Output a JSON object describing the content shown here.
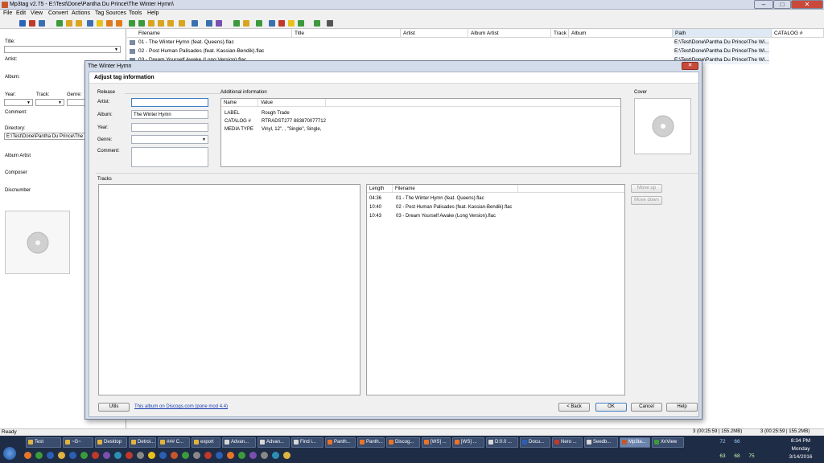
{
  "window": {
    "title": "Mp3tag v2.75  -  E:\\Test\\Done\\Pantha Du Prince\\The Winter Hymn\\",
    "btn_min": "–",
    "btn_max": "□",
    "btn_close": "✕"
  },
  "menu": [
    "File",
    "Edit",
    "View",
    "Convert",
    "Actions",
    "Tag Sources",
    "Tools",
    "Help"
  ],
  "left_panel": {
    "title_label": "Title:",
    "artist_label": "Artist:",
    "album_label": "Album:",
    "year_label": "Year:",
    "track_label": "Track:",
    "genre_label": "Genre:",
    "comment_label": "Comment:",
    "directory_label": "Directory:",
    "directory_value": "E:\\Test\\Done\\Pantha Du Prince\\The Winter Hymn",
    "album_artist_label": "Album Artist",
    "composer_label": "Composer",
    "discnumber_label": "Discnumber"
  },
  "file_list": {
    "columns": [
      "Filename",
      "Title",
      "Artist",
      "Album Artist",
      "Track",
      "Album",
      "Path",
      "CATALOG #"
    ],
    "rows": [
      {
        "filename": "01 - The Winter Hymn (feat. Queens).flac",
        "path": "E:\\Test\\Done\\Pantha Du Prince\\The Wi..."
      },
      {
        "filename": "02 - Post Human Palisades (feat. Kassian-Bendik).flac",
        "path": "E:\\Test\\Done\\Pantha Du Prince\\The Wi..."
      },
      {
        "filename": "03 - Dream Yourself Awake (Long Version).flac",
        "path": "E:\\Test\\Done\\Pantha Du Prince\\The Wi..."
      }
    ]
  },
  "dialog": {
    "title": "The Winter Hymn",
    "close": "✕",
    "heading": "Adjust tag information",
    "release_group": "Release",
    "artist_label": "Artist:",
    "artist_value": "",
    "album_label": "Album:",
    "album_value": "The Winter Hymn",
    "year_label": "Year:",
    "year_value": "",
    "genre_label": "Genre:",
    "genre_value": "",
    "comment_label": "Comment:",
    "comment_value": "",
    "additional_group": "Additional information",
    "additional_columns": [
      "Name",
      "Value"
    ],
    "additional_rows": [
      {
        "name": "LABEL",
        "value": "Rough Trade"
      },
      {
        "name": "CATALOG #",
        "value": "RTRADST277 883870077712"
      },
      {
        "name": "MEDIA TYPE",
        "value": "Vinyl, 12\", , \"Single\", Single,"
      }
    ],
    "cover_group": "Cover",
    "tracks_group": "Tracks",
    "track_columns": [
      "Length",
      "Filename"
    ],
    "track_rows": [
      {
        "length": "04:36",
        "filename": "01 - The Winter Hymn (feat. Queens).flac"
      },
      {
        "length": "10:40",
        "filename": "02 - Post Human Palisades (feat. Kassian-Bendik).flac"
      },
      {
        "length": "10:43",
        "filename": "03 - Dream Yourself Awake (Long Version).flac"
      }
    ],
    "move_up": "Move up",
    "move_down": "Move down",
    "utils": "Utils",
    "discogs_link": "This album on Discogs.com (pone mod 4.4)",
    "back": "< Back",
    "ok": "OK",
    "cancel": "Cancel",
    "help": "Help"
  },
  "status": {
    "left": "Ready",
    "right1": "3 (00:25:59 | 155.2MB)",
    "right2": "3 (00:25:59 | 155.2MB)"
  },
  "taskbar": {
    "tasks": [
      "Test",
      "~G~",
      "Desktop",
      "Detroi...",
      "### C...",
      "export",
      "Advan...",
      "Advan...",
      "Find i...",
      "Panth...",
      "Panth...",
      "Discog...",
      "[WS] ...",
      "[WS] ...",
      "D:0.0 ...",
      "Docu...",
      "Nero ...",
      "Seedb...",
      "Mp3ta...",
      "XnView"
    ],
    "time": "8:34 PM",
    "day": "Monday",
    "date": "3/14/2016",
    "tray_a": "72",
    "tray_b": "66",
    "tray_c": "63",
    "tray_d": "68",
    "tray_e": "75"
  },
  "colors": {
    "taskbar": "#1e2c45",
    "dialog_frame": "#d3dcea",
    "link": "#1a3fb0",
    "close": "#c94a3b"
  }
}
